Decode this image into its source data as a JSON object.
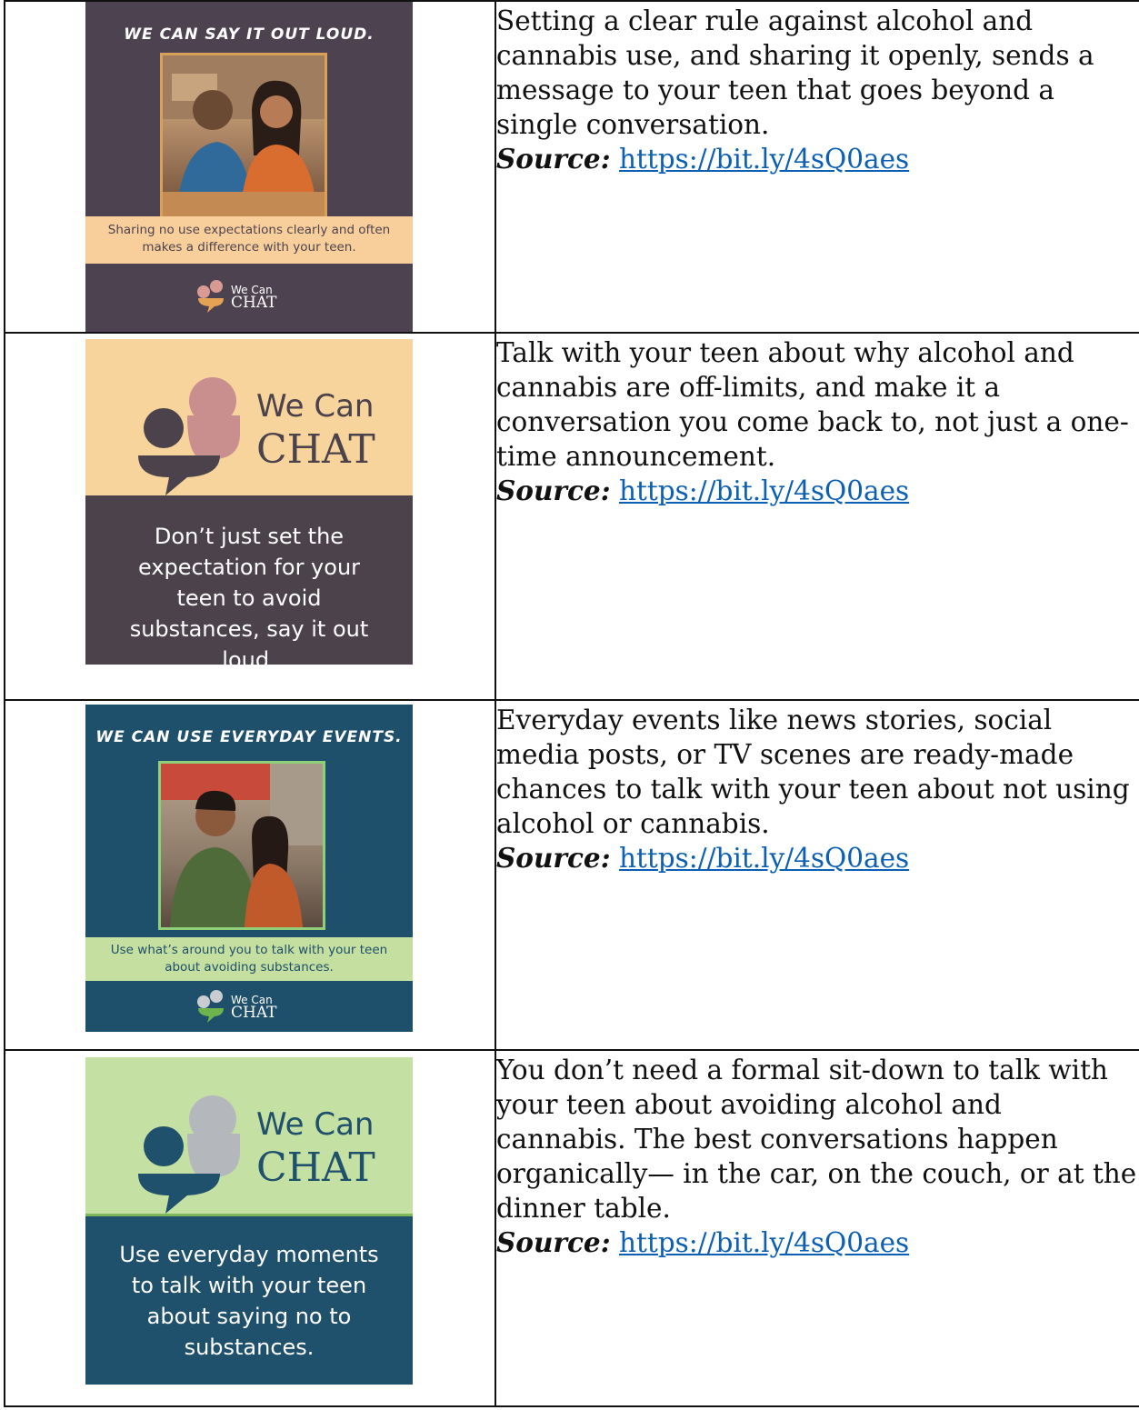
{
  "rows": [
    {
      "card": {
        "headline": "WE CAN SAY IT OUT LOUD.",
        "band_text": "Sharing no use expectations clearly and often makes a difference with your teen.",
        "logo_small": "We Can",
        "logo_big": "CHAT",
        "bg": "#4d4350",
        "band_bg": "#f8cf9a",
        "accent1": "#d89a92",
        "accent2": "#e3a254"
      },
      "text": "Setting a clear rule against alcohol and cannabis use, and sharing it openly, sends a message to your teen that goes beyond a single conversation.",
      "source_label": "Source:",
      "source_url": "https://bit.ly/4sQ0aes"
    },
    {
      "card": {
        "logo_small": "We Can",
        "logo_big": "CHAT",
        "message": "Don’t just set the expectation for your teen to avoid substances, say it out loud.",
        "top_bg": "#f7d49c",
        "bottom_bg": "#4b424b",
        "accent1": "#c98f8f",
        "accent2": "#4b424b"
      },
      "text": "Talk with your teen about why alcohol and cannabis are off-limits, and make it a conversation you come back to, not just a one-time announcement.",
      "source_label": "Source:",
      "source_url": "https://bit.ly/4sQ0aes"
    },
    {
      "card": {
        "headline": "WE CAN USE EVERYDAY EVENTS.",
        "band_text": "Use what’s around you to talk with your teen about avoiding substances.",
        "logo_small": "We Can",
        "logo_big": "CHAT",
        "bg": "#1e4f6b",
        "band_bg": "#c4dfa0",
        "accent1": "#c9cdd1",
        "accent2": "#6db44c"
      },
      "text": "Everyday events like news stories, social media posts, or TV scenes are ready-made chances to talk with your teen about not using alcohol or cannabis.",
      "source_label": "Source:",
      "source_url": "https://bit.ly/4sQ0aes"
    },
    {
      "card": {
        "logo_small": "We Can",
        "logo_big": "CHAT",
        "message": "Use everyday moments to talk with your teen about saying no to substances.",
        "top_bg": "#c5e0a3",
        "bottom_bg": "#1f506c",
        "accent1": "#b4b8bc",
        "accent2": "#1f506c"
      },
      "text": "You don’t need a formal sit-down to talk with your teen about avoiding alcohol and cannabis. The best conversations happen organically— in the car, on the couch, or at the dinner table.",
      "source_label": "Source:",
      "source_url": "https://bit.ly/4sQ0aes"
    }
  ]
}
